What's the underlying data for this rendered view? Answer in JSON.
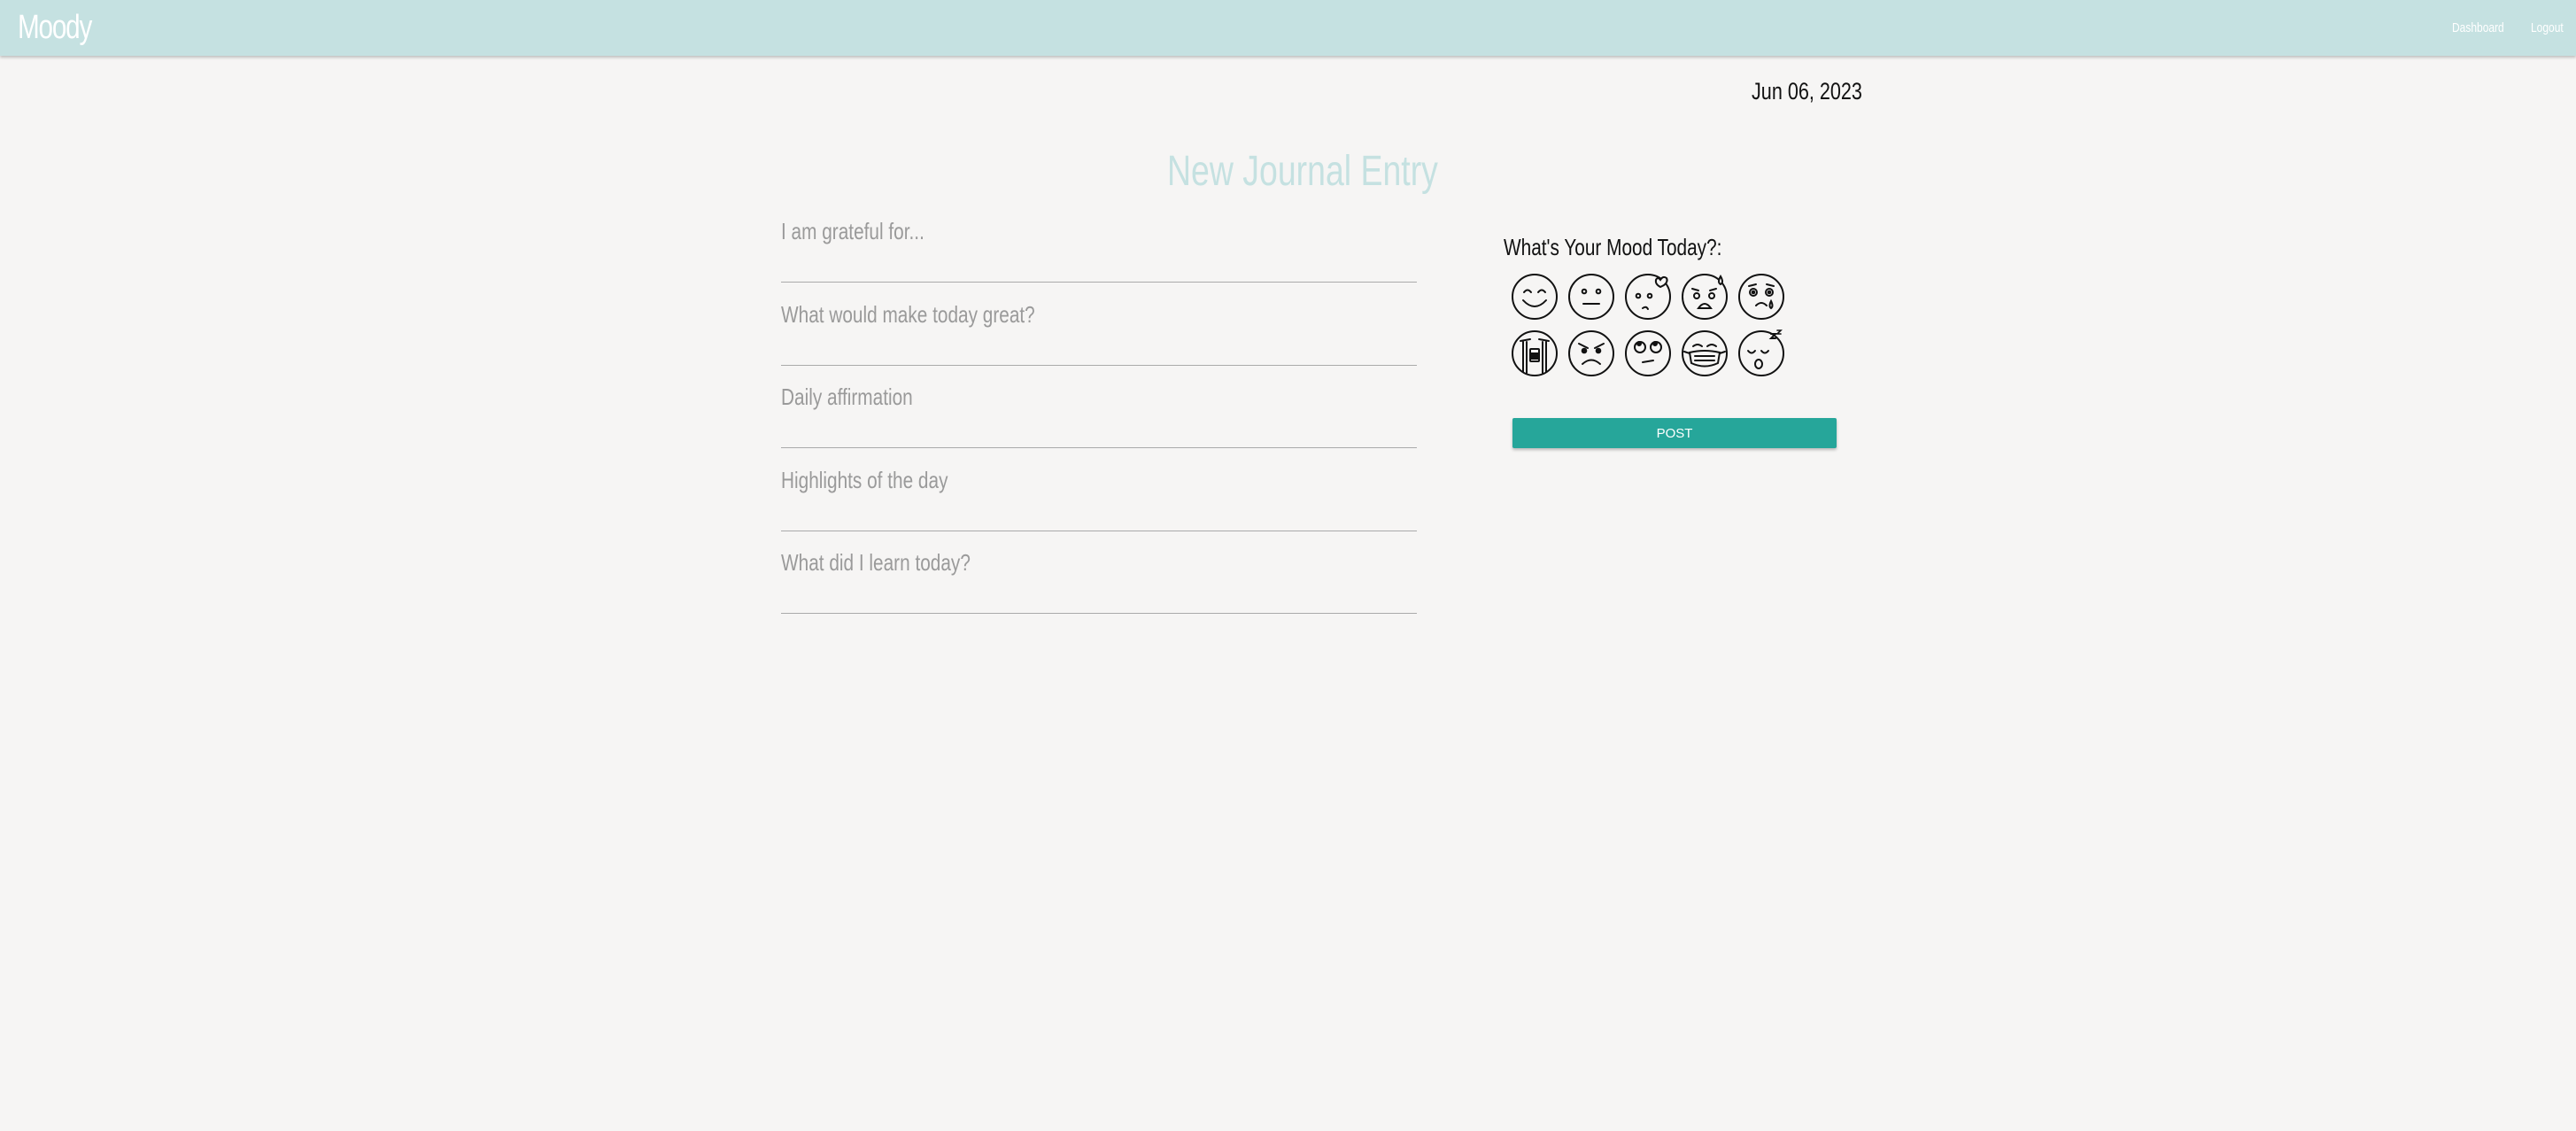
{
  "navbar": {
    "brand": "Moody",
    "links": {
      "dashboard": "Dashboard",
      "logout": "Logout"
    }
  },
  "date": "Jun 06, 2023",
  "page": {
    "title": "New Journal Entry"
  },
  "journal": {
    "fields": [
      {
        "placeholder": "I am grateful for..."
      },
      {
        "placeholder": "What would make today great?"
      },
      {
        "placeholder": "Daily affirmation"
      },
      {
        "placeholder": "Highlights of the day"
      },
      {
        "placeholder": "What did I learn today?"
      }
    ]
  },
  "mood": {
    "label": "What's Your Mood Today?:",
    "icons": [
      "smiling-face-icon",
      "neutral-face-icon",
      "flirty-face-icon",
      "sweating-face-icon",
      "crying-face-icon",
      "sobbing-face-icon",
      "angry-face-icon",
      "eye-roll-face-icon",
      "masked-face-icon",
      "sleeping-face-icon"
    ]
  },
  "actions": {
    "post_label": "POST"
  },
  "colors": {
    "navbar_bg": "#c5e1e1",
    "accent": "#26a69a",
    "title": "#c5e1e1",
    "background": "#f6f5f4"
  }
}
